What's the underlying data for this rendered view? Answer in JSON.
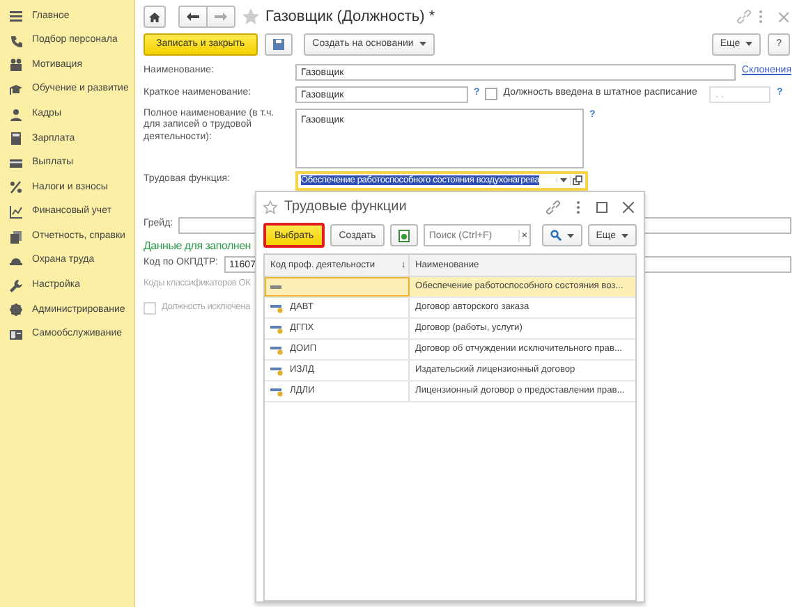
{
  "sidebar": {
    "items": [
      {
        "label": "Главное",
        "selected": false
      },
      {
        "label": "Подбор персонала",
        "selected": false
      },
      {
        "label": "Мотивация",
        "selected": false
      },
      {
        "label": "Обучение и развитие",
        "selected": false
      },
      {
        "label": "Кадры",
        "selected": false
      },
      {
        "label": "Зарплата",
        "selected": false
      },
      {
        "label": "Выплаты",
        "selected": false
      },
      {
        "label": "Налоги и взносы",
        "selected": false
      },
      {
        "label": "Финансовый учет",
        "selected": false
      },
      {
        "label": "Отчетность, справки",
        "selected": false
      },
      {
        "label": "Охрана труда",
        "selected": false
      },
      {
        "label": "Настройка",
        "selected": false
      },
      {
        "label": "Администрирование",
        "selected": false
      },
      {
        "label": "Самообслуживание",
        "selected": false
      }
    ]
  },
  "window": {
    "title": "Газовщик (Должность) *"
  },
  "toolbar": {
    "save_close": "Записать и закрыть",
    "create_based": "Создать на основании",
    "more": "Еще",
    "help": "?"
  },
  "form": {
    "name": {
      "label": "Наименование:",
      "value": "Газовщик",
      "link": "Склонения"
    },
    "short_name": {
      "label": "Краткое наименование:",
      "value": "Газовщик",
      "help": "?"
    },
    "staffing": {
      "label": "Должность введена в штатное расписание",
      "checked": false,
      "disabled": false,
      "date": ". .",
      "help": "?"
    },
    "full_name": {
      "label": "Полное наименование (в т.ч. для записей о трудовой деятельности):",
      "value": "Газовщик",
      "help": "?"
    },
    "labor_function": {
      "label": "Трудовая функция:",
      "value": "Обеспечение работоспособного состояния воздухонагрева",
      "focused": true
    },
    "grade": {
      "label": "Грейд:"
    },
    "section": "Данные для заполнен",
    "okpdtr": {
      "label": "Код по ОКПДТР:",
      "value": "11607"
    },
    "classifiers": "Коды классификаторов ОК",
    "excluded": {
      "label": "Должность исключена",
      "checked": false,
      "disabled": true
    }
  },
  "dialog": {
    "title": "Трудовые функции",
    "select": "Выбрать",
    "create": "Создать",
    "search_placeholder": "Поиск (Ctrl+F)",
    "clear": "×",
    "more": "Еще",
    "table": {
      "columns": [
        {
          "label": "Код проф. деятельности",
          "sort_mark": "↓"
        },
        {
          "label": "Наименование"
        }
      ],
      "rows": [
        {
          "kind": "blank",
          "code": "",
          "name": "Обеспечение работоспособного состояния воз...",
          "selected": true
        },
        {
          "kind": "item",
          "code": "ДАВТ",
          "name": "Договор авторского заказа",
          "selected": false
        },
        {
          "kind": "item",
          "code": "ДГПХ",
          "name": "Договор (работы, услуги)",
          "selected": false
        },
        {
          "kind": "item",
          "code": "ДОИП",
          "name": "Договор об отчуждении исключительного прав...",
          "selected": false
        },
        {
          "kind": "item",
          "code": "ИЗЛД",
          "name": "Издательский лицензионный договор",
          "selected": false
        },
        {
          "kind": "item",
          "code": "ЛДЛИ",
          "name": "Лицензионный договор о предоставлении прав...",
          "selected": false
        }
      ]
    }
  }
}
